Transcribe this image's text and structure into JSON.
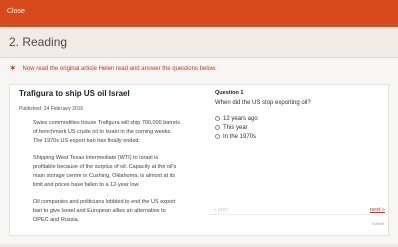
{
  "topbar": {
    "close_label": "Close"
  },
  "page": {
    "title": "2. Reading"
  },
  "instruction": {
    "text": "Now read the original article Helen read and answer the questions below."
  },
  "article": {
    "title": "Trafigura to ship US oil Israel",
    "published": "Published: 24 February 2016",
    "paragraphs": [
      "Swiss commodities house Trafigura will ship 700,000 barrels of benchmark US crude oil to Israel in the coming weeks. The 1970s US export ban has finally ended.",
      "Shipping West Texas Intermediate (WTI) to Israel is profitable because of the surplus of oil. Capacity at the oil's main storage centre in Cushing, Oklahoma, is almost at its limit and prices have fallen to a 12-year low.",
      "Oil companies and politicians lobbied to end the US export ban to give Israel and European allies an alternative to OPEC and Russia."
    ]
  },
  "question": {
    "number": "Question 1",
    "text": "When did the US stop exporting oil?",
    "options": [
      "12 years ago",
      "This year",
      "In the 1970s"
    ]
  },
  "nav": {
    "prev_label": "« prev",
    "next_label": "next »",
    "submit_label": "Submit"
  },
  "colors": {
    "accent": "#d84a1b",
    "title_bg": "#f1ebe7",
    "link": "#c7381a"
  },
  "icons": {
    "instruction": "star-icon"
  }
}
